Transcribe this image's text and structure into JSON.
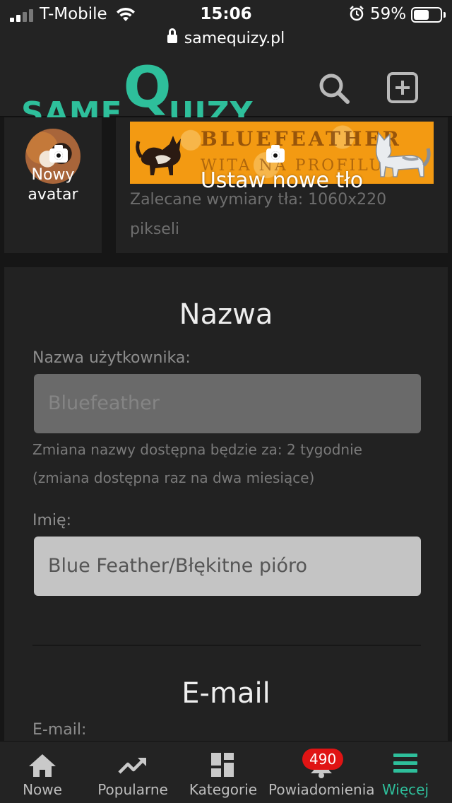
{
  "status_bar": {
    "carrier": "T-Mobile",
    "time": "15:06",
    "battery_percent": "59%",
    "battery_level": 0.59,
    "url": "samequizy.pl"
  },
  "header": {
    "logo_small": "SAME",
    "logo_big": "Q",
    "logo_tail": "UIZY",
    "search_icon": "search-icon",
    "add_icon": "plus-square-icon",
    "accent_color": "#2ebf9b"
  },
  "avatar": {
    "label": "Nowy avatar"
  },
  "background": {
    "banner_title": "BLUEFEATHER",
    "banner_subtitle": "WITA NA PROFILU",
    "label": "Ustaw nowe tło",
    "hint": "Zalecane wymiary tła: 1060x220 pikseli"
  },
  "name_section": {
    "title": "Nazwa",
    "username_label": "Nazwa użytkownika:",
    "username_value": "Bluefeather",
    "change_hint_1": "Zmiana nazwy dostępna będzie za: 2 tygodnie",
    "change_hint_2": "(zmiana dostępna raz na dwa miesiące)",
    "first_name_label": "Imię:",
    "first_name_value": "Blue Feather/Błękitne pióro"
  },
  "email_section": {
    "title": "E-mail",
    "email_label": "E-mail:"
  },
  "tabbar": {
    "items": [
      {
        "label": "Nowe",
        "icon": "home-icon"
      },
      {
        "label": "Popularne",
        "icon": "trending-icon"
      },
      {
        "label": "Kategorie",
        "icon": "grid-icon"
      },
      {
        "label": "Powiadomienia",
        "icon": "bell-icon",
        "badge": "490"
      },
      {
        "label": "Więcej",
        "icon": "menu-icon",
        "active": true
      }
    ],
    "badge_color": "#e01414"
  }
}
